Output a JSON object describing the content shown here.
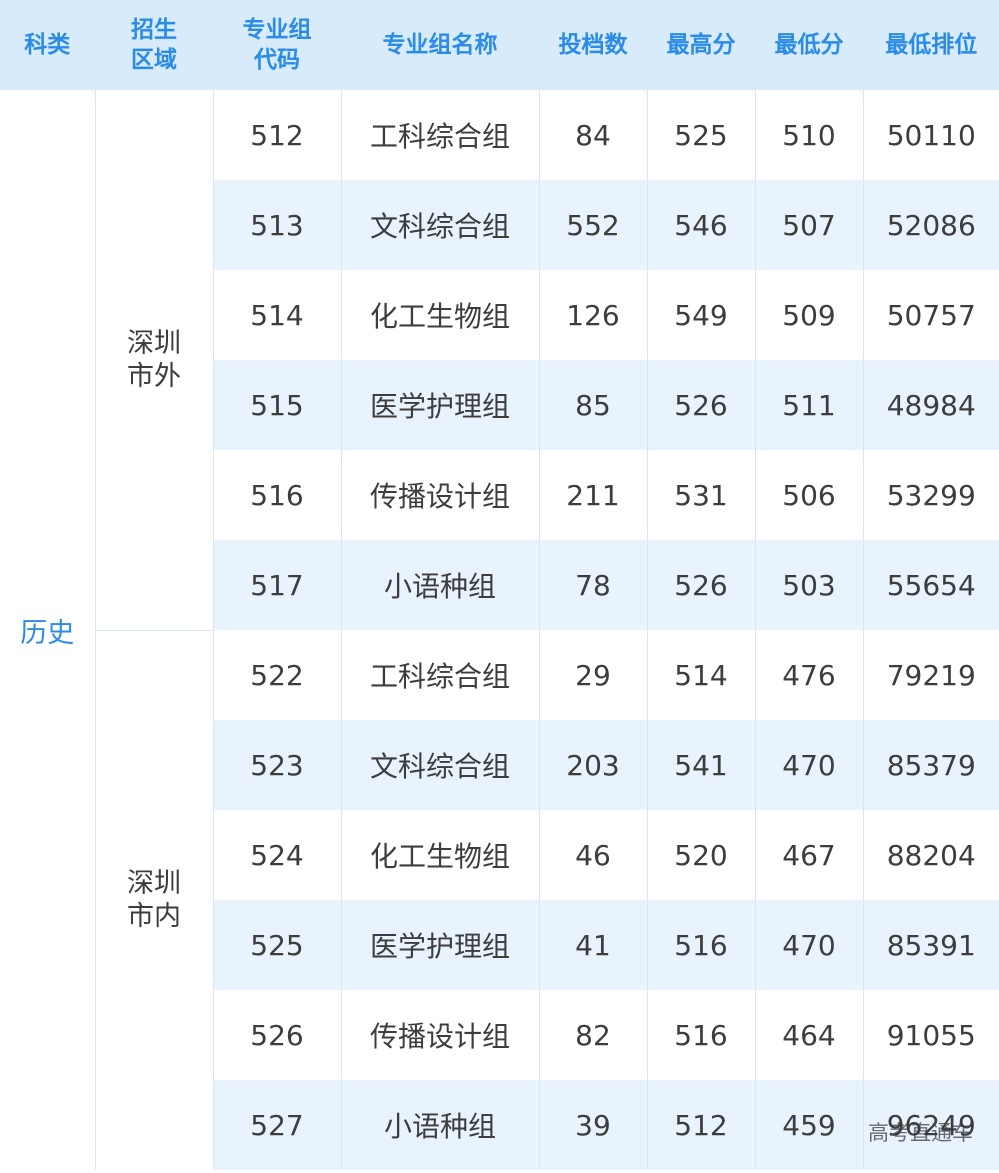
{
  "headers": {
    "subject": "科类",
    "region": [
      "招生",
      "区域"
    ],
    "code": [
      "专业组",
      "代码"
    ],
    "name": "专业组名称",
    "count": "投档数",
    "max": "最高分",
    "min": "最低分",
    "rank": "最低排位"
  },
  "subject": "历史",
  "regions": [
    {
      "name": [
        "深圳",
        "市外"
      ],
      "rows": [
        {
          "code": "512",
          "name": "工科综合组",
          "count": "84",
          "max": "525",
          "min": "510",
          "rank": "50110"
        },
        {
          "code": "513",
          "name": "文科综合组",
          "count": "552",
          "max": "546",
          "min": "507",
          "rank": "52086"
        },
        {
          "code": "514",
          "name": "化工生物组",
          "count": "126",
          "max": "549",
          "min": "509",
          "rank": "50757"
        },
        {
          "code": "515",
          "name": "医学护理组",
          "count": "85",
          "max": "526",
          "min": "511",
          "rank": "48984"
        },
        {
          "code": "516",
          "name": "传播设计组",
          "count": "211",
          "max": "531",
          "min": "506",
          "rank": "53299"
        },
        {
          "code": "517",
          "name": "小语种组",
          "count": "78",
          "max": "526",
          "min": "503",
          "rank": "55654"
        }
      ]
    },
    {
      "name": [
        "深圳",
        "市内"
      ],
      "rows": [
        {
          "code": "522",
          "name": "工科综合组",
          "count": "29",
          "max": "514",
          "min": "476",
          "rank": "79219"
        },
        {
          "code": "523",
          "name": "文科综合组",
          "count": "203",
          "max": "541",
          "min": "470",
          "rank": "85379"
        },
        {
          "code": "524",
          "name": "化工生物组",
          "count": "46",
          "max": "520",
          "min": "467",
          "rank": "88204"
        },
        {
          "code": "525",
          "name": "医学护理组",
          "count": "41",
          "max": "516",
          "min": "470",
          "rank": "85391"
        },
        {
          "code": "526",
          "name": "传播设计组",
          "count": "82",
          "max": "516",
          "min": "464",
          "rank": "91055"
        },
        {
          "code": "527",
          "name": "小语种组",
          "count": "39",
          "max": "512",
          "min": "459",
          "rank": "96249"
        }
      ]
    }
  ],
  "watermark": "高考直通车"
}
